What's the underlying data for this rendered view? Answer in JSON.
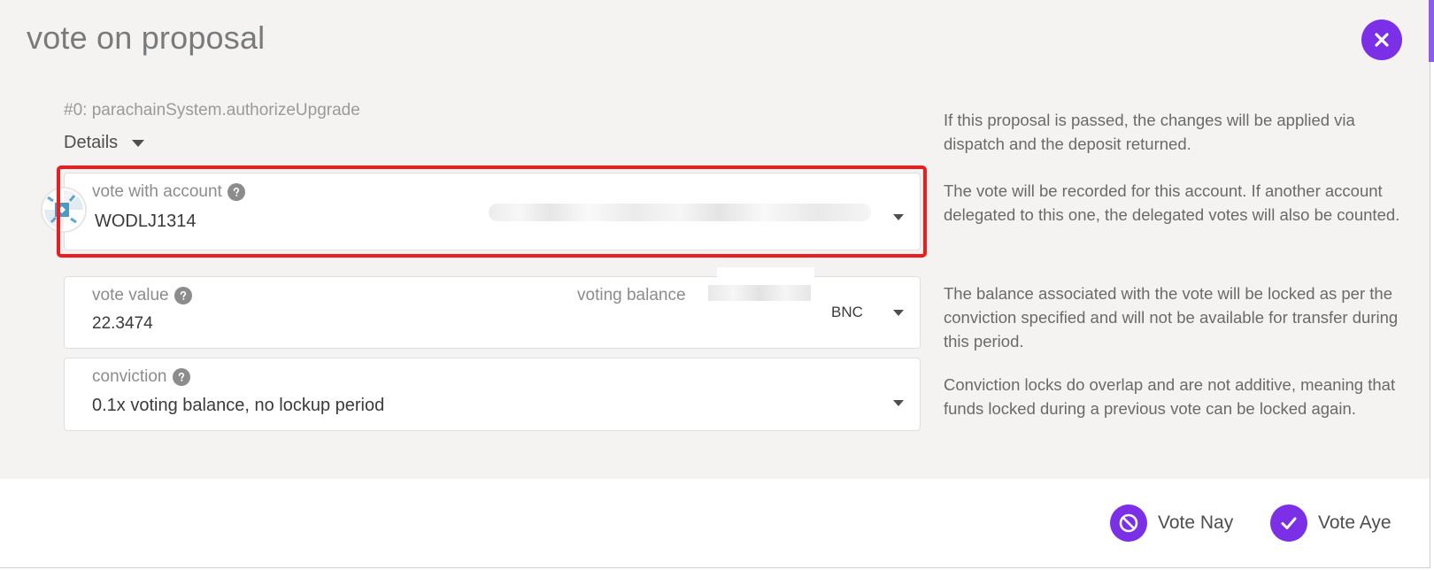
{
  "modal": {
    "title": "vote on proposal",
    "proposal_id": "#0: parachainSystem.authorizeUpgrade",
    "details_label": "Details"
  },
  "account_field": {
    "label": "vote with account",
    "value": "WODLJ1314"
  },
  "vote_value_field": {
    "label": "vote value",
    "value": "22.3474",
    "balance_label": "voting balance",
    "unit": "BNC"
  },
  "conviction_field": {
    "label": "conviction",
    "value": "0.1x voting balance, no lockup period"
  },
  "help": {
    "proposal": "If this proposal is passed, the changes will be applied via dispatch and the deposit returned.",
    "account": "The vote will be recorded for this account. If another account delegated to this one, the delegated votes will also be counted.",
    "balance": "The balance associated with the vote will be locked as per the conviction specified and will not be available for transfer during this period.",
    "conviction": "Conviction locks do overlap and are not additive, meaning that funds locked during a previous vote can be locked again."
  },
  "actions": {
    "nay_label": "Vote Nay",
    "aye_label": "Vote Aye"
  },
  "colors": {
    "accent": "#7b2fe6",
    "highlight": "#ee1c1c",
    "body_bg": "#f4f3f2"
  },
  "icons": {
    "close": "close-icon",
    "help": "question-circle-icon",
    "nay": "ban-icon",
    "aye": "check-icon",
    "dropdown": "caret-down-icon",
    "identicon": "identicon"
  }
}
